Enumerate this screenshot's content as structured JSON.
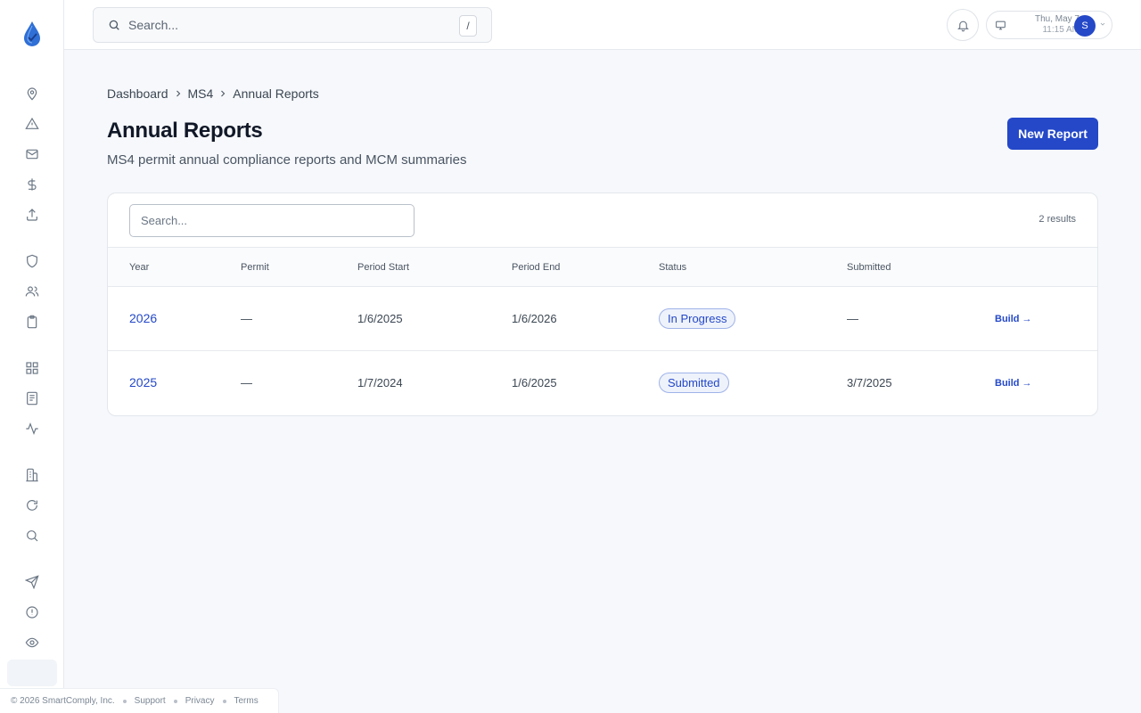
{
  "topbar": {
    "search_placeholder": "Search...",
    "search_shortcut": "/",
    "date": "Thu, May 7",
    "time": "11:15 AM",
    "avatar_initial": "S"
  },
  "sidebar": {
    "items": [
      {
        "icon": "map-pin-icon"
      },
      {
        "icon": "alert-triangle-icon"
      },
      {
        "icon": "mail-icon"
      },
      {
        "icon": "dollar-icon"
      },
      {
        "icon": "upload-icon"
      },
      {
        "icon": "shield-icon"
      },
      {
        "icon": "users-icon"
      },
      {
        "icon": "clipboard-icon"
      },
      {
        "icon": "grid-icon"
      },
      {
        "icon": "document-icon"
      },
      {
        "icon": "activity-icon"
      },
      {
        "icon": "building-icon"
      },
      {
        "icon": "refresh-icon"
      },
      {
        "icon": "search-icon"
      },
      {
        "icon": "send-icon"
      },
      {
        "icon": "alert-circle-icon"
      },
      {
        "icon": "eye-icon"
      }
    ]
  },
  "breadcrumb": [
    "Dashboard",
    "MS4",
    "Annual Reports"
  ],
  "page": {
    "title": "Annual Reports",
    "subtitle": "MS4 permit annual compliance reports and MCM summaries",
    "new_button": "New Report"
  },
  "table": {
    "search_placeholder": "Search...",
    "results_count": "2 results",
    "columns": [
      "Year",
      "Permit",
      "Period Start",
      "Period End",
      "Status",
      "Submitted"
    ],
    "rows": [
      {
        "year": "2026",
        "permit": "—",
        "period_start": "1/6/2025",
        "period_end": "1/6/2026",
        "status": "In Progress",
        "submitted": "—",
        "action": "Build →"
      },
      {
        "year": "2025",
        "permit": "—",
        "period_start": "1/7/2024",
        "period_end": "1/6/2025",
        "status": "Submitted",
        "submitted": "3/7/2025",
        "action": "Build →"
      }
    ]
  },
  "footer": {
    "copyright": "© 2026 SmartComply, Inc.",
    "links": [
      "Support",
      "Privacy",
      "Terms"
    ]
  },
  "colors": {
    "accent": "#2448c8",
    "badge_bg": "#eef2fb",
    "badge_border": "#9fb3e8"
  }
}
